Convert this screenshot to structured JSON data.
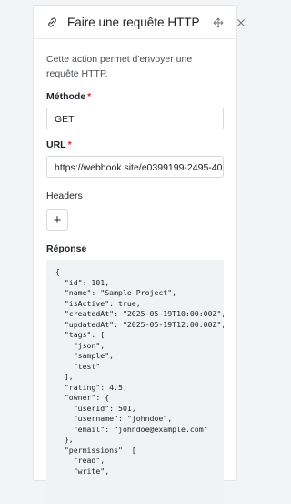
{
  "panel": {
    "title": "Faire une requête HTTP",
    "icons": {
      "title": "link-icon",
      "move": "move-icon",
      "close": "close-icon"
    }
  },
  "description": "Cette action permet d'envoyer une requête HTTP.",
  "method": {
    "label": "Méthode",
    "required_mark": "*",
    "value": "GET"
  },
  "url": {
    "label": "URL",
    "required_mark": "*",
    "value": "https://webhook.site/e0399199-2495-40"
  },
  "headers": {
    "label": "Headers",
    "add_label": "+"
  },
  "response": {
    "label": "Réponse",
    "lines": [
      "{",
      "  \"id\": 101,",
      "  \"name\": \"Sample Project\",",
      "  \"isActive\": true,",
      "  \"createdAt\": \"2025-05-19T10:00:00Z\",",
      "  \"updatedAt\": \"2025-05-19T12:00:00Z\",",
      "  \"tags\": [",
      "    \"json\",",
      "    \"sample\",",
      "    \"test\"",
      "  ],",
      "  \"rating\": 4.5,",
      "  \"owner\": {",
      "    \"userId\": 501,",
      "    \"username\": \"johndoe\",",
      "    \"email\": \"johndoe@example.com\"",
      "  },",
      "  \"permissions\": [",
      "    \"read\",",
      "    \"write\","
    ]
  }
}
